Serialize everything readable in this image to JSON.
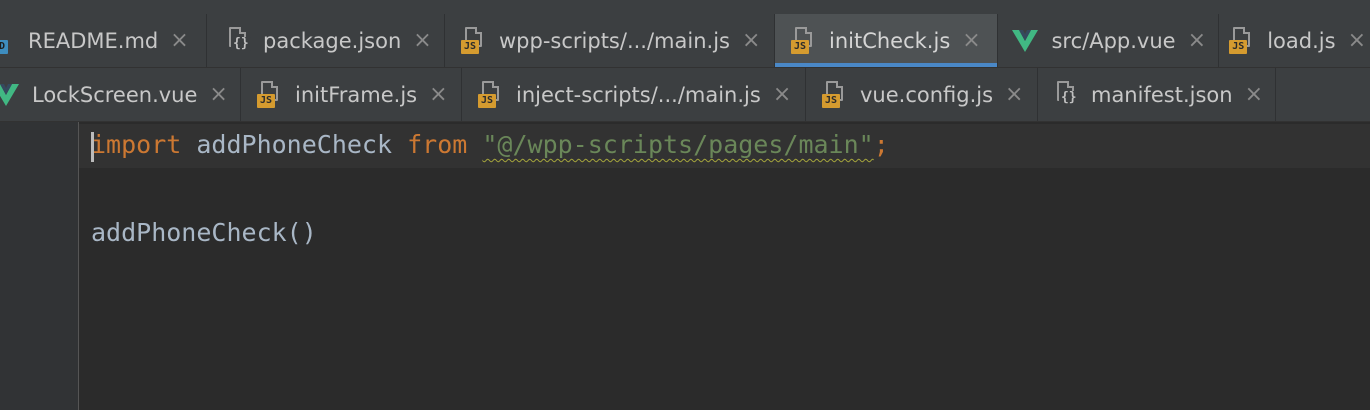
{
  "tabs_row1": [
    {
      "label": "README.md",
      "icon": "md-file-icon",
      "badge": "MD",
      "active": false
    },
    {
      "label": "package.json",
      "icon": "json-file-icon",
      "badge": "{}",
      "active": false
    },
    {
      "label": "wpp-scripts/.../main.js",
      "icon": "js-file-icon",
      "badge": "JS",
      "active": false
    },
    {
      "label": "initCheck.js",
      "icon": "js-file-icon",
      "badge": "JS",
      "active": true
    },
    {
      "label": "src/App.vue",
      "icon": "vue-file-icon",
      "badge": "",
      "active": false
    },
    {
      "label": "load.js",
      "icon": "js-file-icon",
      "badge": "JS",
      "active": false
    }
  ],
  "tabs_row2": [
    {
      "label": "LockScreen.vue",
      "icon": "vue-file-icon",
      "badge": "",
      "active": false
    },
    {
      "label": "initFrame.js",
      "icon": "js-file-icon",
      "badge": "JS",
      "active": false
    },
    {
      "label": "inject-scripts/.../main.js",
      "icon": "js-file-icon",
      "badge": "JS",
      "active": false
    },
    {
      "label": "vue.config.js",
      "icon": "js-file-icon",
      "badge": "JS",
      "active": false
    },
    {
      "label": "manifest.json",
      "icon": "json-file-icon",
      "badge": "{}",
      "active": false
    }
  ],
  "close_glyph": "×",
  "editor": {
    "line1": {
      "kw1": "import",
      "ident": " addPhoneCheck ",
      "kw2": "from",
      "space": " ",
      "string": "\"@/wpp-scripts/pages/main\"",
      "semi": ";"
    },
    "line3": "addPhoneCheck()"
  },
  "colors": {
    "keyword": "#cc7832",
    "string": "#6a8759",
    "active_underline": "#4a88c7",
    "js_badge": "#d59b2f",
    "vue_green": "#41b883"
  }
}
